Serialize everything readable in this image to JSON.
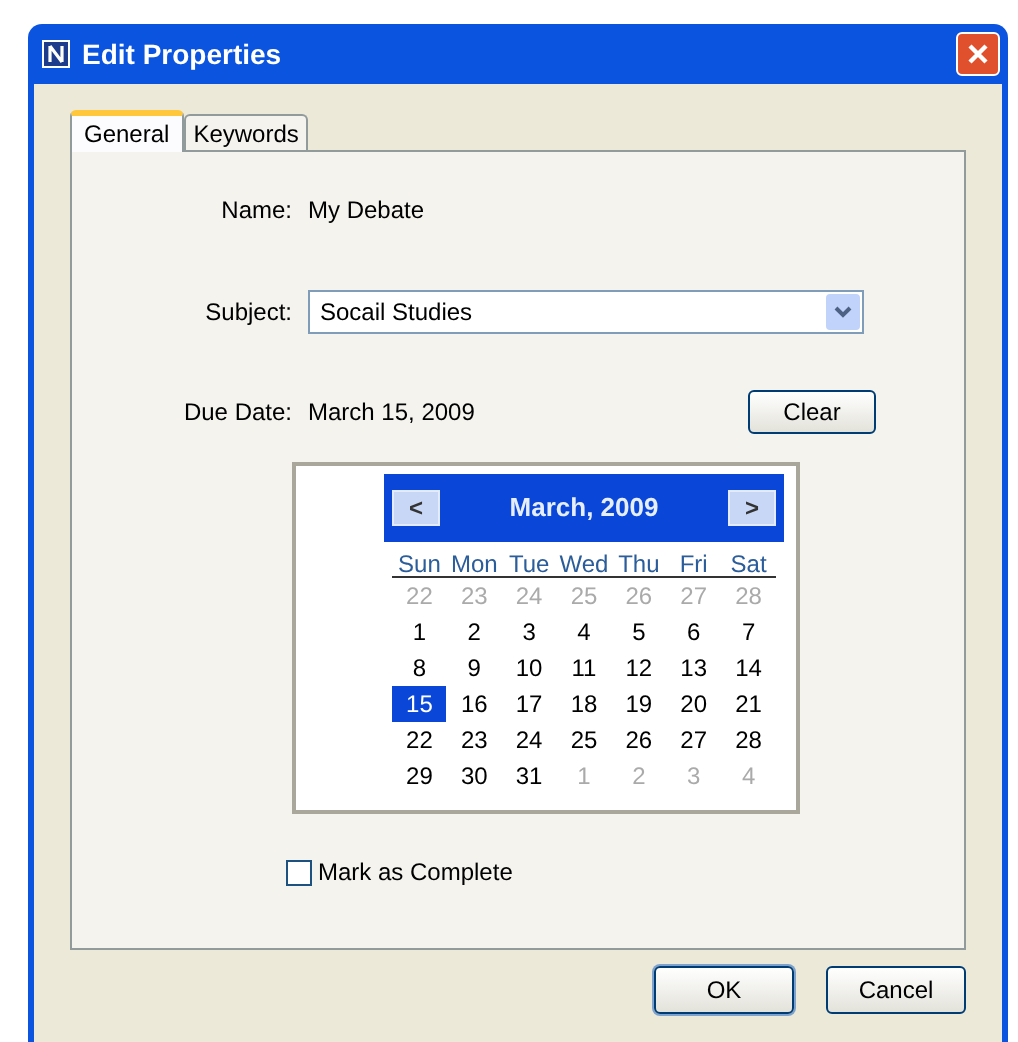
{
  "window": {
    "title": "Edit Properties"
  },
  "tabs": [
    {
      "label": "General",
      "selected": true
    },
    {
      "label": "Keywords",
      "selected": false
    }
  ],
  "name": {
    "label": "Name:",
    "value": "My Debate"
  },
  "subject": {
    "label": "Subject:",
    "value": "Socail Studies"
  },
  "due_date": {
    "label": "Due Date:",
    "value": "March 15, 2009",
    "clear_button": "Clear"
  },
  "calendar": {
    "prev": "<",
    "title": "March, 2009",
    "next": ">",
    "weekdays": [
      "Sun",
      "Mon",
      "Tue",
      "Wed",
      "Thu",
      "Fri",
      "Sat"
    ],
    "weeks": [
      [
        {
          "day": "22",
          "other_month": true,
          "selected": false
        },
        {
          "day": "23",
          "other_month": true,
          "selected": false
        },
        {
          "day": "24",
          "other_month": true,
          "selected": false
        },
        {
          "day": "25",
          "other_month": true,
          "selected": false
        },
        {
          "day": "26",
          "other_month": true,
          "selected": false
        },
        {
          "day": "27",
          "other_month": true,
          "selected": false
        },
        {
          "day": "28",
          "other_month": true,
          "selected": false
        }
      ],
      [
        {
          "day": "1",
          "other_month": false,
          "selected": false
        },
        {
          "day": "2",
          "other_month": false,
          "selected": false
        },
        {
          "day": "3",
          "other_month": false,
          "selected": false
        },
        {
          "day": "4",
          "other_month": false,
          "selected": false
        },
        {
          "day": "5",
          "other_month": false,
          "selected": false
        },
        {
          "day": "6",
          "other_month": false,
          "selected": false
        },
        {
          "day": "7",
          "other_month": false,
          "selected": false
        }
      ],
      [
        {
          "day": "8",
          "other_month": false,
          "selected": false
        },
        {
          "day": "9",
          "other_month": false,
          "selected": false
        },
        {
          "day": "10",
          "other_month": false,
          "selected": false
        },
        {
          "day": "11",
          "other_month": false,
          "selected": false
        },
        {
          "day": "12",
          "other_month": false,
          "selected": false
        },
        {
          "day": "13",
          "other_month": false,
          "selected": false
        },
        {
          "day": "14",
          "other_month": false,
          "selected": false
        }
      ],
      [
        {
          "day": "15",
          "other_month": false,
          "selected": true
        },
        {
          "day": "16",
          "other_month": false,
          "selected": false
        },
        {
          "day": "17",
          "other_month": false,
          "selected": false
        },
        {
          "day": "18",
          "other_month": false,
          "selected": false
        },
        {
          "day": "19",
          "other_month": false,
          "selected": false
        },
        {
          "day": "20",
          "other_month": false,
          "selected": false
        },
        {
          "day": "21",
          "other_month": false,
          "selected": false
        }
      ],
      [
        {
          "day": "22",
          "other_month": false,
          "selected": false
        },
        {
          "day": "23",
          "other_month": false,
          "selected": false
        },
        {
          "day": "24",
          "other_month": false,
          "selected": false
        },
        {
          "day": "25",
          "other_month": false,
          "selected": false
        },
        {
          "day": "26",
          "other_month": false,
          "selected": false
        },
        {
          "day": "27",
          "other_month": false,
          "selected": false
        },
        {
          "day": "28",
          "other_month": false,
          "selected": false
        }
      ],
      [
        {
          "day": "29",
          "other_month": false,
          "selected": false
        },
        {
          "day": "30",
          "other_month": false,
          "selected": false
        },
        {
          "day": "31",
          "other_month": false,
          "selected": false
        },
        {
          "day": "1",
          "other_month": true,
          "selected": false
        },
        {
          "day": "2",
          "other_month": true,
          "selected": false
        },
        {
          "day": "3",
          "other_month": true,
          "selected": false
        },
        {
          "day": "4",
          "other_month": true,
          "selected": false
        }
      ]
    ]
  },
  "mark_complete": {
    "label": "Mark as Complete",
    "checked": false
  },
  "buttons": [
    "OK",
    "Cancel"
  ]
}
